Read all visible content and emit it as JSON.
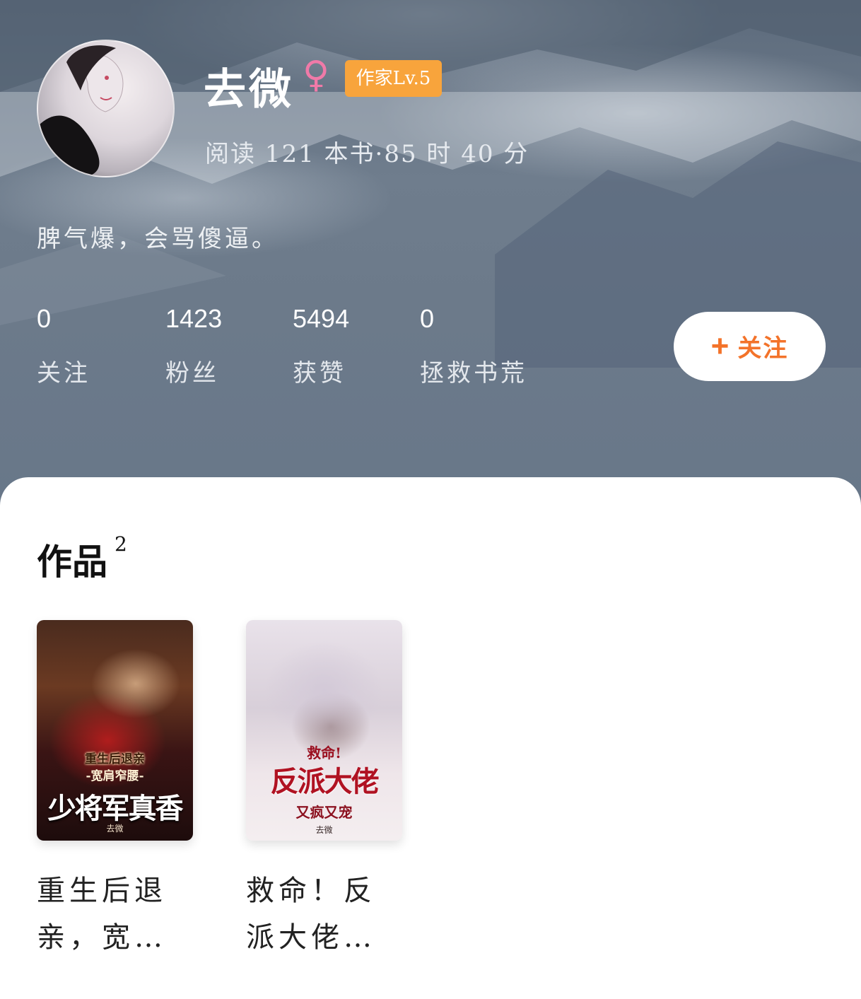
{
  "profile": {
    "name": "去微",
    "gender_symbol": "♀",
    "level_badge": "作家Lv.5",
    "reading_stats": "阅读 121 本书·85 时 40 分",
    "bio": "脾气爆，会骂傻逼。"
  },
  "stats": [
    {
      "value": "0",
      "label": "关注"
    },
    {
      "value": "1423",
      "label": "粉丝"
    },
    {
      "value": "5494",
      "label": "获赞"
    },
    {
      "value": "0",
      "label": "拯救书荒"
    }
  ],
  "follow_button": {
    "icon": "+",
    "label": "关注"
  },
  "works": {
    "title": "作品",
    "count": "2",
    "books": [
      {
        "title": "重生后退亲，宽…",
        "cover_lines": [
          "重生后退亲",
          "-宽肩窄腰-",
          "少将军真香",
          "去微"
        ]
      },
      {
        "title": "救命！反派大佬…",
        "cover_lines": [
          "救命!",
          "反派大佬",
          "又疯又宠",
          "去微"
        ]
      }
    ]
  },
  "colors": {
    "accent": "#f3732a",
    "badge": "#f8a43c",
    "gender": "#f07aa8",
    "header_bg": "#6c7a8a"
  }
}
